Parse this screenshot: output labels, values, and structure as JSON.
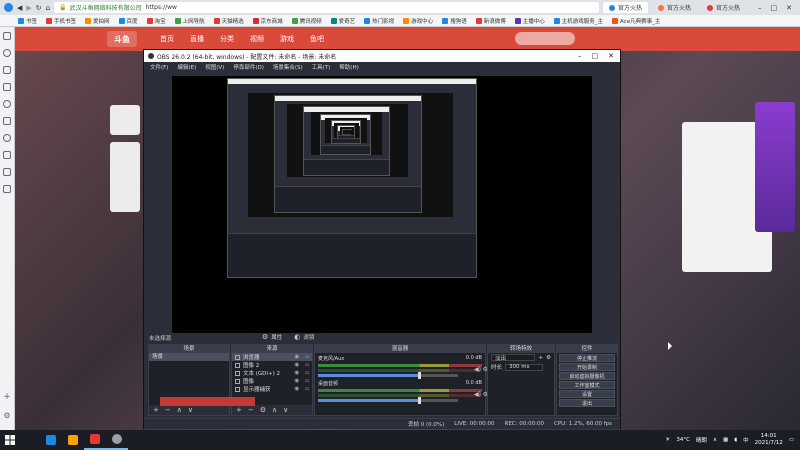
{
  "browser": {
    "tabs": [
      {
        "label": "官方火热",
        "color": "#1e88e5"
      },
      {
        "label": "官方火热",
        "color": "#ff7043"
      },
      {
        "label": "官方火热",
        "color": "#e53935"
      }
    ],
    "url": "https://ww",
    "site_label": "武汉斗鱼网络科技有限公司",
    "bookmarks": [
      "书签",
      "手机书签",
      "爱拍网",
      "百度",
      "淘宝",
      "上网导航",
      "天猫精选",
      "京东商城",
      "腾讯视频",
      "爱奇艺",
      "热门影视",
      "游戏中心",
      "搜狗语",
      "新浪微博",
      "主播中心",
      "主机游戏服务_主",
      "Ace凡典赛事_主"
    ]
  },
  "site": {
    "nav": [
      "首页",
      "直播",
      "分类",
      "视频",
      "游戏",
      "鱼吧"
    ],
    "logo": "斗鱼",
    "search_placeholder": ""
  },
  "obs": {
    "title": "OBS 26.0.2 (64-bit, windows) - 配置文件: 未命名 - 场景: 未命名",
    "menu": [
      "文件(F)",
      "编辑(E)",
      "视图(V)",
      "停靠部件(D)",
      "场景集合(S)",
      "工具(T)",
      "帮助(H)"
    ],
    "scene_selected_label": "未选择源",
    "filters_label": "属性",
    "filters_label2": "滤镜",
    "docks": {
      "scenes": {
        "title": "场景",
        "items": [
          "场景"
        ]
      },
      "sources": {
        "title": "来源",
        "items": [
          {
            "label": "浏览器",
            "selected": true
          },
          {
            "label": "图像 2",
            "selected": false
          },
          {
            "label": "文本 (GDI+) 2",
            "selected": false
          },
          {
            "label": "图像",
            "selected": false
          },
          {
            "label": "显示器捕获",
            "selected": false
          }
        ]
      },
      "mixer": {
        "title": "混音器",
        "channels": [
          {
            "name": "麦克风/Aux",
            "db": "0.0 dB",
            "level": 0.72
          },
          {
            "name": "桌面音频",
            "db": "0.0 dB",
            "level": 0.72
          }
        ]
      },
      "transitions": {
        "title": "转场特效",
        "type": "淡出",
        "duration_label": "时长",
        "duration": "300 ms"
      },
      "controls": {
        "title": "控件",
        "buttons": [
          "停止推流",
          "开始录制",
          "启动虚拟摄像机",
          "工作室模式",
          "设置",
          "退出"
        ]
      }
    },
    "status": {
      "live": "LIVE: 00:00:00",
      "rec": "REC: 00:00:00",
      "cpu": "CPU: 1.2%, 60.00 fps",
      "dropped": "丢帧 0 (0.0%)"
    }
  },
  "taskbar": {
    "apps": [
      {
        "color": "#1e88e5",
        "on": false
      },
      {
        "color": "#ffa000",
        "on": false
      },
      {
        "color": "#e53935",
        "on": true
      },
      {
        "color": "#9e9e9e",
        "on": true
      }
    ],
    "temp": "34°C",
    "weather": "晴朗",
    "ime": "中",
    "time": "14:01",
    "date": "2021/7/12"
  }
}
